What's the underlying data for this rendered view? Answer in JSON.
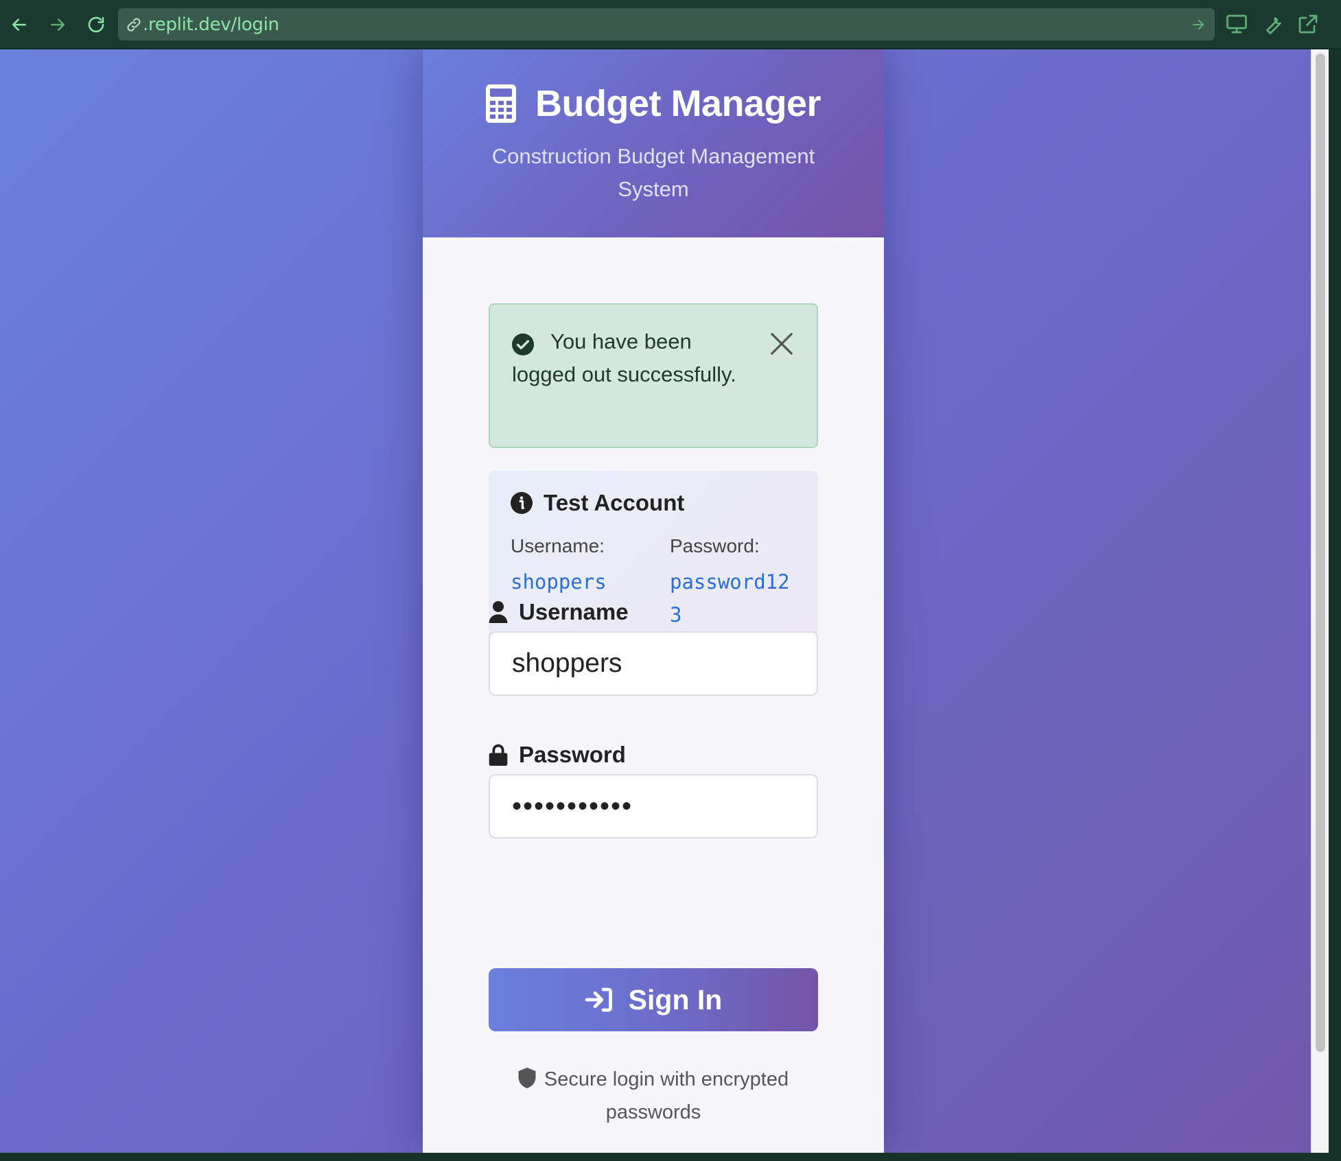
{
  "browser": {
    "url": ".replit.dev/login",
    "icons": [
      "back-arrow-icon",
      "forward-arrow-icon",
      "reload-icon",
      "link-icon",
      "go-arrow-icon",
      "monitor-icon",
      "wrench-icon",
      "external-link-icon"
    ]
  },
  "header": {
    "title": "Budget Manager",
    "subtitle": "Construction Budget Management System",
    "icon": "calculator-icon"
  },
  "alert": {
    "message": "You have been logged out successfully.",
    "icon": "check-circle-icon",
    "close_icon": "close-icon"
  },
  "test_account": {
    "title": "Test Account",
    "username_label": "Username:",
    "username_value": "shoppers",
    "password_label": "Password:",
    "password_value": "password123"
  },
  "form": {
    "username_label": "Username",
    "username_value": "shoppers",
    "password_label": "Password",
    "password_masked": "•••••••••••",
    "submit_label": "Sign In"
  },
  "footer": {
    "secure_text": "Secure login with encrypted passwords"
  },
  "colors": {
    "gradient_start": "#6a80de",
    "gradient_end": "#7454a8",
    "alert_bg": "#d3e7dd",
    "link_blue": "#2a6fd8",
    "url_green": "#8ee6a6"
  }
}
